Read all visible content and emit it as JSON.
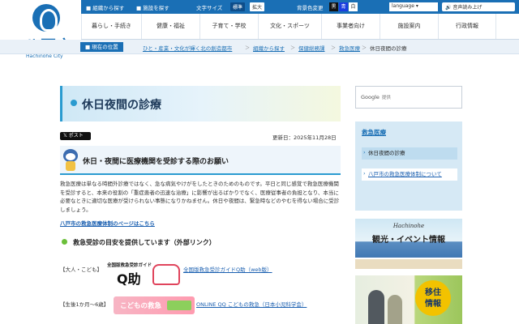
{
  "logo": {
    "name_ja": "八戸市",
    "name_en": "Hachinohe City"
  },
  "topbar": {
    "links": [
      "組織から探す",
      "施設を探す"
    ],
    "font_size_label": "文字サイズ",
    "font_size_options": [
      "標準",
      "拡大"
    ],
    "bg_color_label": "背景色変更",
    "bg_colors": [
      "黒",
      "青",
      "白"
    ],
    "language": "language",
    "voice": "音声読み上げ"
  },
  "nav": {
    "items": [
      "暮らし・手続き",
      "健康・福祉",
      "子育て・学校",
      "文化・スポーツ",
      "事業者向け",
      "施設案内",
      "行政情報"
    ]
  },
  "breadcrumb": {
    "label": "現在の位置",
    "items": [
      "ひと・産業・文化が輝く北の創造都市",
      "組織から探す",
      "保健総務課",
      "救急医療"
    ],
    "current": "休日夜間の診療"
  },
  "page": {
    "title": "休日夜間の診療",
    "post_button": "ポスト",
    "updated": "更新日：2025年11月28日",
    "heading": "休日・夜間に医療機関を受診する際のお願い",
    "paragraph": "救急医療は単なる時間外診療ではなく、急な病気やけがをしたときのためのものです。平日と同じ感覚で救急医療機関を受診すると、本来の役割の「重症患者の迅速な治療」に影響が出るばかりでなく、医療従事者の負担となり、本当に必要なときに適切な医療が受けられない事態になりかねません。休日や夜間は、緊急時などのやむを得ない場合に受診しましょう。",
    "link": "八戸市の救急医療体制のページはこちら",
    "subheading": "救急受診の目安を提供しています（外部リンク）",
    "rows": [
      {
        "label": "【大人・こども】",
        "banner_small": "全国版救急受診ガイド",
        "banner_big": "Q助",
        "link": "全国版救急受診ガイドQ助（web版）"
      },
      {
        "label": "【生後1か月～6歳】",
        "banner_text": "こどもの救急",
        "link": "ONLINE QQ こどもの救急（日本小児科学会）"
      }
    ]
  },
  "sidebar": {
    "search_label": "Google",
    "search_sub": "提供",
    "panel_title": "救急医療",
    "items": [
      {
        "label": "休日夜間の診療",
        "active": true
      },
      {
        "label": "八戸市の救急医療体制について",
        "active": false
      }
    ],
    "banner1": {
      "heading": "Hachinohe",
      "text": "観光・イベント情報"
    },
    "banner2": {
      "line1": "移住",
      "line2": "情報"
    }
  }
}
